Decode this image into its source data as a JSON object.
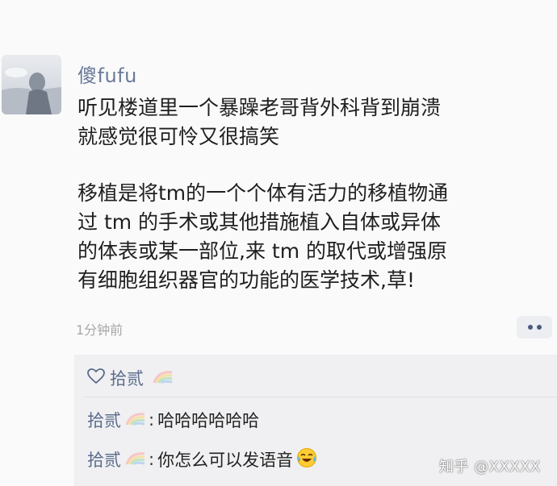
{
  "post": {
    "username": "傻fufu",
    "paragraph1": "听见楼道里一个暴躁老哥背外科背到崩溃\n就感觉很可怜又很搞笑",
    "paragraph2": "移植是将tm的一个个体有活力的移植物通\n过 tm 的手术或其他措施植入自体或异体\n的体表或某一部位,来 tm 的取代或增强原\n有细胞组织器官的功能的医学技术,草!",
    "time": "1分钟前"
  },
  "replies": {
    "like_user": "拾贰",
    "comments": [
      {
        "author": "拾贰",
        "separator": ":",
        "text": "哈哈哈哈哈哈"
      },
      {
        "author": "拾贰",
        "separator": ":",
        "text": "你怎么可以发语音"
      }
    ]
  },
  "watermark": "知乎 @XXXXX",
  "icons": {
    "like": "heart-outline-icon",
    "badge": "rainbow-badge-icon",
    "more": "more-dots-icon",
    "emoji": "laughing-tears-emoji"
  },
  "colors": {
    "link": "#5a6b8c",
    "username": "#6b7a99",
    "reply_bg": "#f0f0f2",
    "time": "#a7a7a7"
  }
}
